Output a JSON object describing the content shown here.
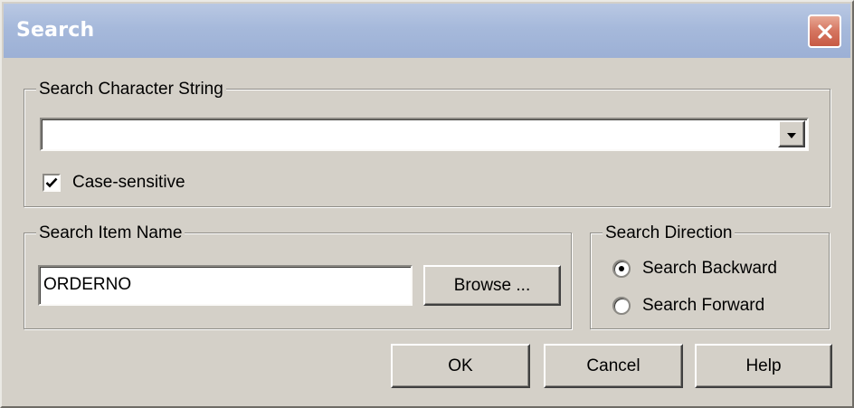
{
  "window": {
    "title": "Search",
    "close_icon": "close-icon"
  },
  "search_string": {
    "group_label": "Search Character String",
    "value": "",
    "dropdown_icon": "chevron-down-icon",
    "case_sensitive": {
      "label": "Case-sensitive",
      "checked": true
    }
  },
  "item_name": {
    "group_label": "Search Item Name",
    "value": "ORDERNO",
    "browse_label": "Browse ..."
  },
  "direction": {
    "group_label": "Search Direction",
    "options": [
      {
        "label": "Search Backward",
        "selected": true
      },
      {
        "label": "Search Forward",
        "selected": false
      }
    ]
  },
  "buttons": {
    "ok": "OK",
    "cancel": "Cancel",
    "help": "Help"
  }
}
